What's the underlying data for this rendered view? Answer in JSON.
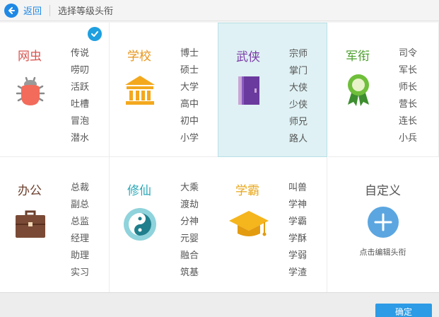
{
  "header": {
    "back_label": "返回",
    "title": "选择等级头衔"
  },
  "categories": [
    {
      "name": "网虫",
      "color": "#d9534f",
      "icon": "bug-icon",
      "titles": [
        "传说",
        "唠叨",
        "活跃",
        "吐槽",
        "冒泡",
        "潜水"
      ],
      "selected": false,
      "checked": true
    },
    {
      "name": "学校",
      "color": "#e8951b",
      "icon": "school-building-icon",
      "titles": [
        "博士",
        "硕士",
        "大学",
        "高中",
        "初中",
        "小学"
      ],
      "selected": false,
      "checked": false
    },
    {
      "name": "武侠",
      "color": "#7b3aa8",
      "icon": "book-icon",
      "titles": [
        "宗师",
        "掌门",
        "大侠",
        "少侠",
        "师兄",
        "路人"
      ],
      "selected": true,
      "checked": false
    },
    {
      "name": "军衔",
      "color": "#4a9f2b",
      "icon": "medal-icon",
      "titles": [
        "司令",
        "军长",
        "师长",
        "营长",
        "连长",
        "小兵"
      ],
      "selected": false,
      "checked": false
    },
    {
      "name": "办公",
      "color": "#6b3e2c",
      "icon": "briefcase-icon",
      "titles": [
        "总裁",
        "副总",
        "总监",
        "经理",
        "助理",
        "实习"
      ],
      "selected": false,
      "checked": false
    },
    {
      "name": "修仙",
      "color": "#2aa9b8",
      "icon": "yin-yang-icon",
      "titles": [
        "大乘",
        "渡劫",
        "分神",
        "元婴",
        "融合",
        "筑基"
      ],
      "selected": false,
      "checked": false
    },
    {
      "name": "学霸",
      "color": "#e8a71b",
      "icon": "graduation-cap-icon",
      "titles": [
        "叫兽",
        "学神",
        "学霸",
        "学酥",
        "学弱",
        "学渣"
      ],
      "selected": false,
      "checked": false
    }
  ],
  "custom": {
    "title": "自定义",
    "subtitle": "点击编辑头衔",
    "icon": "plus-icon"
  },
  "footer": {
    "confirm_label": "确定"
  }
}
